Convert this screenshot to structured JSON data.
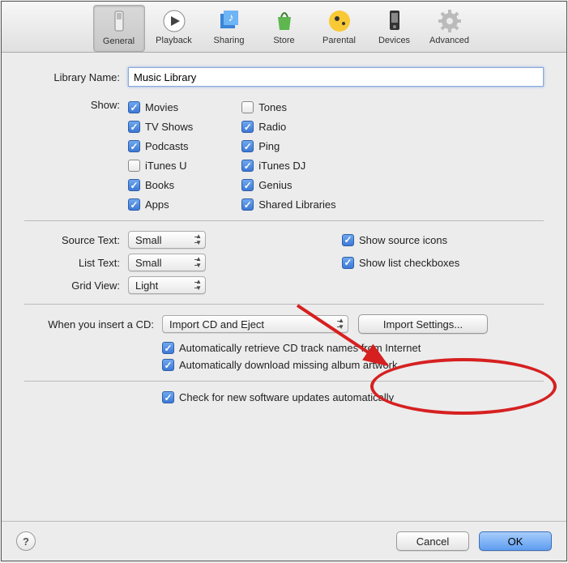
{
  "toolbar": {
    "items": [
      {
        "label": "General",
        "icon": "switch"
      },
      {
        "label": "Playback",
        "icon": "play"
      },
      {
        "label": "Sharing",
        "icon": "music-note"
      },
      {
        "label": "Store",
        "icon": "bag"
      },
      {
        "label": "Parental",
        "icon": "parental"
      },
      {
        "label": "Devices",
        "icon": "phone"
      },
      {
        "label": "Advanced",
        "icon": "gear"
      }
    ],
    "selected": "General"
  },
  "labels": {
    "library_name": "Library Name:",
    "show": "Show:",
    "source_text": "Source Text:",
    "list_text": "List Text:",
    "grid_view": "Grid View:",
    "insert_cd": "When you insert a CD:"
  },
  "library_name_value": "Music Library",
  "show_left": [
    {
      "label": "Movies",
      "checked": true
    },
    {
      "label": "TV Shows",
      "checked": true
    },
    {
      "label": "Podcasts",
      "checked": true
    },
    {
      "label": "iTunes U",
      "checked": false
    },
    {
      "label": "Books",
      "checked": true
    },
    {
      "label": "Apps",
      "checked": true
    }
  ],
  "show_right": [
    {
      "label": "Tones",
      "checked": false
    },
    {
      "label": "Radio",
      "checked": true
    },
    {
      "label": "Ping",
      "checked": true
    },
    {
      "label": "iTunes DJ",
      "checked": true
    },
    {
      "label": "Genius",
      "checked": true
    },
    {
      "label": "Shared Libraries",
      "checked": true
    }
  ],
  "source_text_value": "Small",
  "list_text_value": "Small",
  "grid_view_value": "Light",
  "show_source_icons": {
    "label": "Show source icons",
    "checked": true
  },
  "show_list_checkboxes": {
    "label": "Show list checkboxes",
    "checked": true
  },
  "insert_cd_value": "Import CD and Eject",
  "import_settings_btn": "Import Settings...",
  "auto_retrieve": {
    "label": "Automatically retrieve CD track names from Internet",
    "checked": true
  },
  "auto_artwork": {
    "label": "Automatically download missing album artwork",
    "checked": true
  },
  "check_updates": {
    "label": "Check for new software updates automatically",
    "checked": true
  },
  "buttons": {
    "cancel": "Cancel",
    "ok": "OK"
  },
  "annotation": {
    "ellipse_around": "import-settings-button",
    "arrow": true
  }
}
